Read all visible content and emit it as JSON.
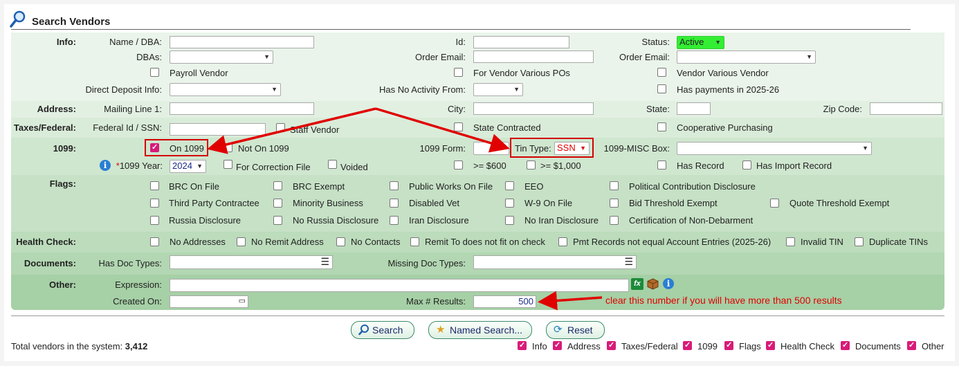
{
  "title": "Search Vendors",
  "sections": {
    "info": "Info:",
    "address": "Address:",
    "taxes": "Taxes/Federal:",
    "n1099": "1099:",
    "flags": "Flags:",
    "health": "Health Check:",
    "documents": "Documents:",
    "other": "Other:"
  },
  "info": {
    "name_dba_label": "Name / DBA:",
    "dbas_label": "DBAs:",
    "payroll_vendor": "Payroll Vendor",
    "direct_deposit_label": "Direct Deposit Info:",
    "id_label": "Id:",
    "order_email_label": "Order Email:",
    "for_vendor_various_pos": "For Vendor Various POs",
    "has_no_activity_label": "Has No Activity From:",
    "status_label": "Status:",
    "status_value": "Active",
    "order_email_label2": "Order Email:",
    "vendor_various_vendor": "Vendor Various Vendor",
    "has_payments": "Has payments in 2025-26"
  },
  "address": {
    "mailing_line1_label": "Mailing Line 1:",
    "city_label": "City:",
    "state_label": "State:",
    "zip_label": "Zip Code:"
  },
  "taxes": {
    "federal_id_label": "Federal Id / SSN:",
    "staff_vendor": "Staff Vendor",
    "state_contracted": "State Contracted",
    "cooperative_purchasing": "Cooperative Purchasing"
  },
  "n1099": {
    "on_1099": "On 1099",
    "not_on_1099": "Not On 1099",
    "form_label": "1099 Form:",
    "tin_type_label": "Tin Type:",
    "tin_type_value": "SSN",
    "misc_box_label": "1099-MISC Box:",
    "year_label_star": "*",
    "year_label": "1099 Year:",
    "year_value": "2024",
    "for_correction_file": "For Correction File",
    "voided": "Voided",
    "ge_600": ">= $600",
    "ge_1000": ">= $1,000",
    "has_record": "Has Record",
    "has_import_record": "Has Import Record"
  },
  "flags": {
    "row1": [
      "BRC On File",
      "BRC Exempt",
      "Public Works On File",
      "EEO",
      "Political Contribution Disclosure"
    ],
    "row2": [
      "Third Party Contractee",
      "Minority Business",
      "Disabled Vet",
      "W-9 On File",
      "Bid Threshold Exempt",
      "Quote Threshold Exempt"
    ],
    "row3": [
      "Russia Disclosure",
      "No Russia Disclosure",
      "Iran Disclosure",
      "No Iran Disclosure",
      "Certification of Non-Debarment"
    ]
  },
  "health": [
    "No Addresses",
    "No Remit Address",
    "No Contacts",
    "Remit To does not fit on check",
    "Pmt Records not equal Account Entries (2025-26)",
    "Invalid TIN",
    "Duplicate TINs"
  ],
  "documents": {
    "has_doc_types_label": "Has Doc Types:",
    "missing_doc_types_label": "Missing Doc Types:"
  },
  "other": {
    "expression_label": "Expression:",
    "created_on_label": "Created On:",
    "max_results_label": "Max # Results:",
    "max_results_value": "500"
  },
  "annotation": "clear this number if you will have more than 500 results",
  "buttons": {
    "search": "Search",
    "named_search": "Named Search...",
    "reset": "Reset"
  },
  "footer": {
    "total_label": "Total vendors in the system:",
    "total_value": "3,412",
    "toggles": [
      "Info",
      "Address",
      "Taxes/Federal",
      "1099",
      "Flags",
      "Health Check",
      "Documents",
      "Other"
    ]
  },
  "colors": {
    "band_light": "#e6f2e6",
    "band_mid": "#cfe6cf",
    "band_dark": "#a9d3a9",
    "status_green": "#33ee33",
    "annotation_red": "#e00000"
  }
}
